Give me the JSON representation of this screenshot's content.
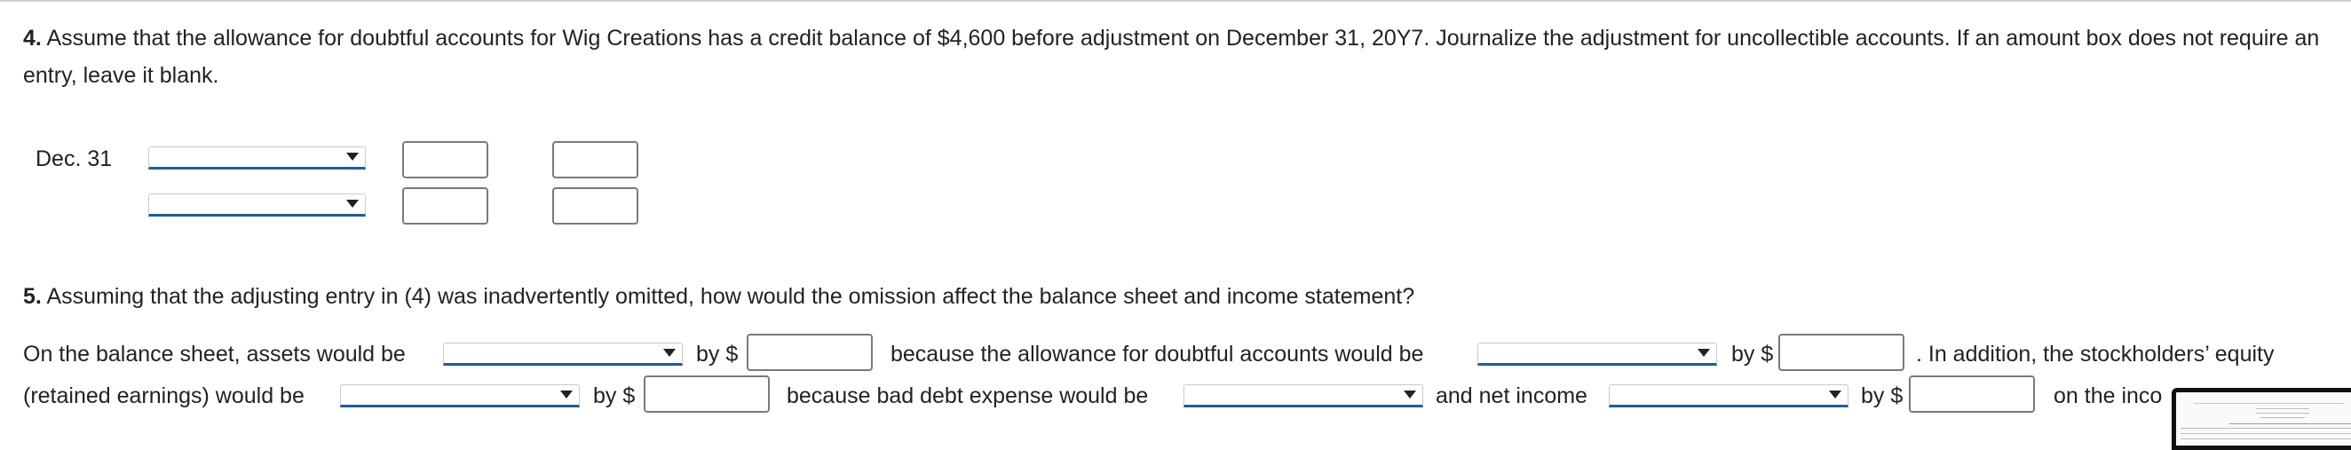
{
  "q4": {
    "number": "4.",
    "text": "Assume that the allowance for doubtful accounts for Wig Creations has a credit balance of $4,600 before adjustment on December 31, 20Y7. Journalize the adjustment for uncollectible accounts. If an amount box does not require an entry, leave it blank.",
    "date_label": "Dec. 31"
  },
  "q5": {
    "number": "5.",
    "text": "Assuming that the adjusting entry in (4) was inadvertently omitted, how would the omission affect the balance sheet and income statement?",
    "line1": {
      "t1": "On the balance sheet, assets would be",
      "t2": "by $",
      "t3": "because the allowance for doubtful accounts would be",
      "t4": "by $",
      "t5": ". In addition, the stockholders’ equity"
    },
    "line2": {
      "t1": "(retained earnings) would be",
      "t2": "by $",
      "t3": "because bad debt expense would be",
      "t4": "and net income",
      "t5": "by $",
      "t6": "on the inco"
    }
  }
}
